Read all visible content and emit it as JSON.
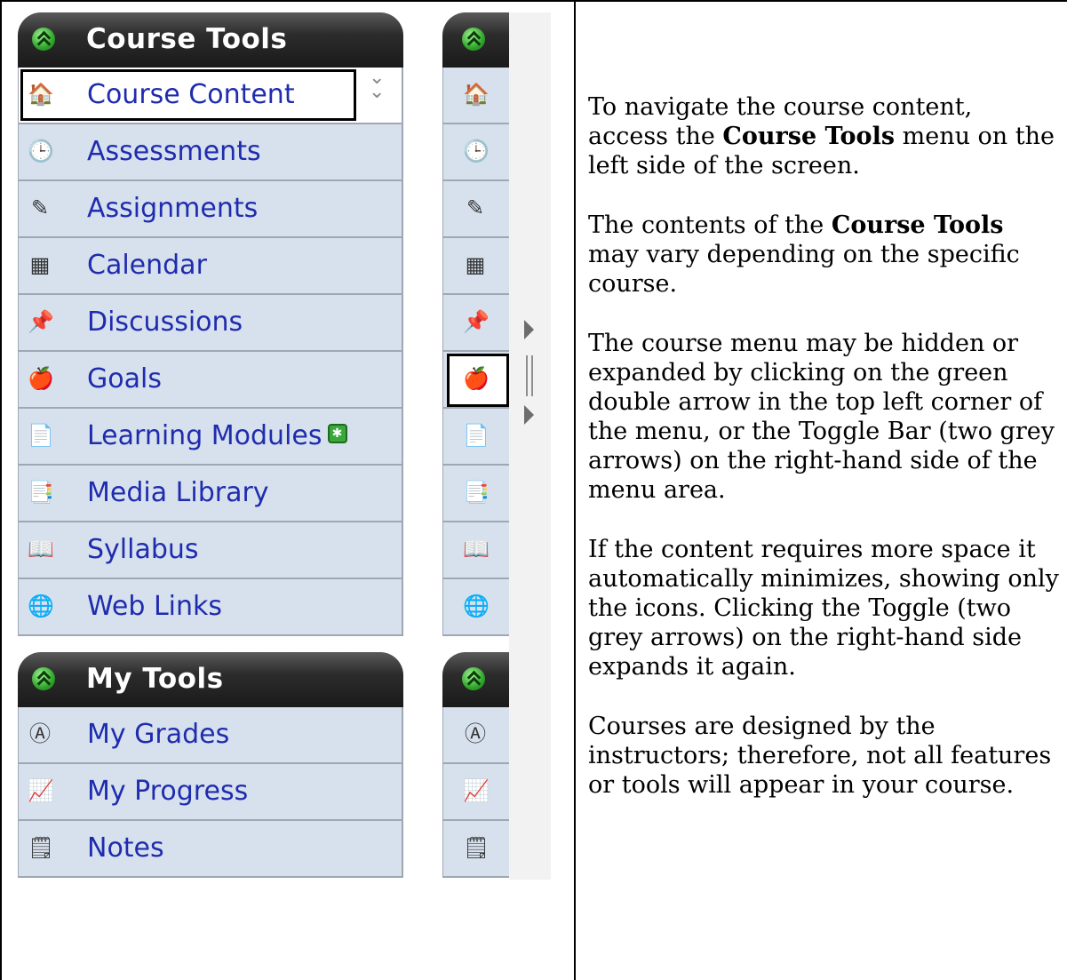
{
  "course_tools": {
    "title": "Course Tools",
    "items": [
      {
        "label": "Course Content",
        "icon": "house-icon",
        "selected": true
      },
      {
        "label": "Assessments",
        "icon": "clock-doc-icon"
      },
      {
        "label": "Assignments",
        "icon": "pencil-doc-icon"
      },
      {
        "label": "Calendar",
        "icon": "calendar-icon"
      },
      {
        "label": "Discussions",
        "icon": "pushpin-icon"
      },
      {
        "label": "Goals",
        "icon": "apple-chart-icon"
      },
      {
        "label": "Learning Modules",
        "icon": "documents-icon",
        "badge": "new-badge-icon"
      },
      {
        "label": "Media Library",
        "icon": "media-doc-icon"
      },
      {
        "label": "Syllabus",
        "icon": "open-book-icon"
      },
      {
        "label": "Web Links",
        "icon": "globe-doc-icon"
      }
    ]
  },
  "my_tools": {
    "title": "My Tools",
    "items": [
      {
        "label": "My Grades",
        "icon": "grade-a-icon"
      },
      {
        "label": "My Progress",
        "icon": "progress-chart-icon"
      },
      {
        "label": "Notes",
        "icon": "note-icon"
      }
    ]
  },
  "colors": {
    "link": "#1f2cae",
    "item_bg": "#d7e1ee",
    "header_bg": "#1a1a1a",
    "toggle_arrow": "#6d6d6d"
  },
  "instructions": {
    "p1_before": "To navigate the course content, access the ",
    "p1_bold": "Course Tools",
    "p1_after": " menu on the left side of the screen.",
    "p2_before": "The contents of the ",
    "p2_bold": "Course Tools",
    "p2_after": " may vary depending on the specific course.",
    "p3": "The course menu may be hidden or expanded by clicking on the green double arrow in the top left corner of the menu, or the Toggle Bar (two grey arrows) on the right-hand side of the menu area.",
    "p4": "If the content requires more space it automatically minimizes, showing only the icons. Clicking the Toggle (two grey arrows) on the right-hand side expands it again.",
    "p5": "Courses are designed by the instructors; therefore, not all features or tools will appear in your course."
  }
}
